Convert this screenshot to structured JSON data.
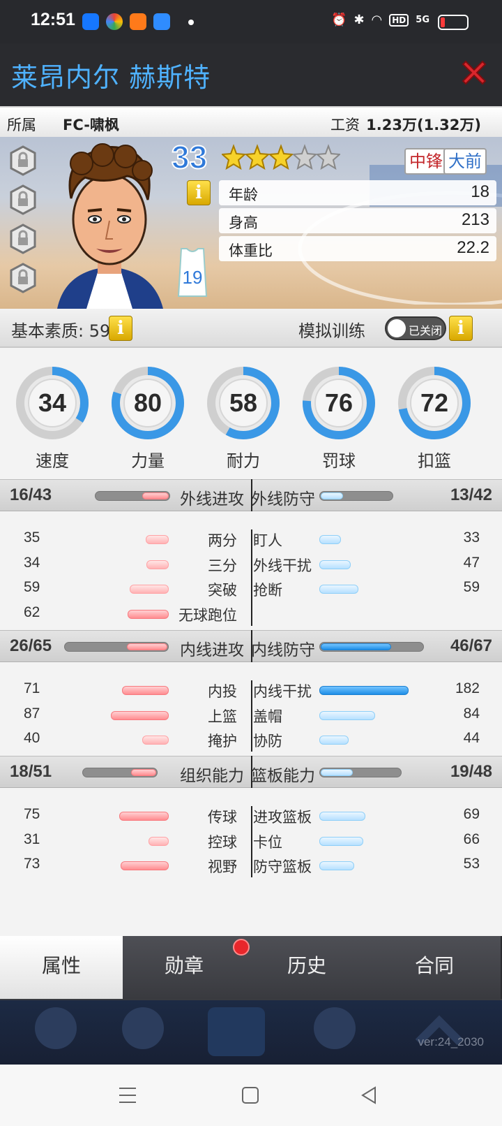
{
  "status": {
    "time": "12:51",
    "net": "5G",
    "hd": "HD"
  },
  "title": "莱昂内尔 赫斯特",
  "info": {
    "team_label": "所属",
    "team": "FC-啸枫",
    "salary_label": "工资",
    "salary": "1.23万(1.32万)"
  },
  "player": {
    "overall": "33",
    "stars": 3,
    "max_stars": 5,
    "jersey": "19",
    "positions": [
      "中锋",
      "大前"
    ],
    "attrs": [
      {
        "label": "年龄",
        "value": "18"
      },
      {
        "label": "身高",
        "value": "213"
      },
      {
        "label": "体重比",
        "value": "22.2"
      }
    ]
  },
  "quality": {
    "label": "基本素质: 59",
    "sim_label": "模拟训练",
    "toggle": "已关闭"
  },
  "gauges": [
    {
      "v": 34,
      "label": "速度"
    },
    {
      "v": 80,
      "label": "力量"
    },
    {
      "v": 58,
      "label": "耐力"
    },
    {
      "v": 76,
      "label": "罚球"
    },
    {
      "v": 72,
      "label": "扣篮"
    }
  ],
  "sections": [
    {
      "left_score": "16/43",
      "left_title": "外线进攻",
      "left_ratio": 0.37,
      "right_title": "外线防守",
      "right_score": "13/42",
      "right_ratio": 0.31,
      "left": [
        {
          "v": "35",
          "n": "两分"
        },
        {
          "v": "34",
          "n": "三分"
        },
        {
          "v": "59",
          "n": "突破"
        },
        {
          "v": "62",
          "n": "无球跑位"
        }
      ],
      "right": [
        {
          "n": "盯人",
          "v": "33"
        },
        {
          "n": "外线干扰",
          "v": "47"
        },
        {
          "n": "抢断",
          "v": "59"
        }
      ]
    },
    {
      "left_score": "26/65",
      "left_title": "内线进攻",
      "left_ratio": 0.4,
      "right_title": "内线防守",
      "right_score": "46/67",
      "right_ratio": 0.69,
      "left": [
        {
          "v": "71",
          "n": "内投"
        },
        {
          "v": "87",
          "n": "上篮"
        },
        {
          "v": "40",
          "n": "掩护"
        }
      ],
      "right": [
        {
          "n": "内线干扰",
          "v": "182"
        },
        {
          "n": "盖帽",
          "v": "84"
        },
        {
          "n": "协防",
          "v": "44"
        }
      ]
    },
    {
      "left_score": "18/51",
      "left_title": "组织能力",
      "left_ratio": 0.35,
      "right_title": "篮板能力",
      "right_score": "19/48",
      "right_ratio": 0.4,
      "left": [
        {
          "v": "75",
          "n": "传球"
        },
        {
          "v": "31",
          "n": "控球"
        },
        {
          "v": "73",
          "n": "视野"
        }
      ],
      "right": [
        {
          "n": "进攻篮板",
          "v": "69"
        },
        {
          "n": "卡位",
          "v": "66"
        },
        {
          "n": "防守篮板",
          "v": "53"
        }
      ]
    }
  ],
  "tabs": [
    "属性",
    "勋章",
    "历史",
    "合同"
  ],
  "version": "ver:24_2030",
  "colors": {
    "accent": "#4fb2ff",
    "attack": "#ff9ea2",
    "defense": "#b6e0ff",
    "highlight": "#1e8ee6",
    "close": "#d9262c"
  }
}
